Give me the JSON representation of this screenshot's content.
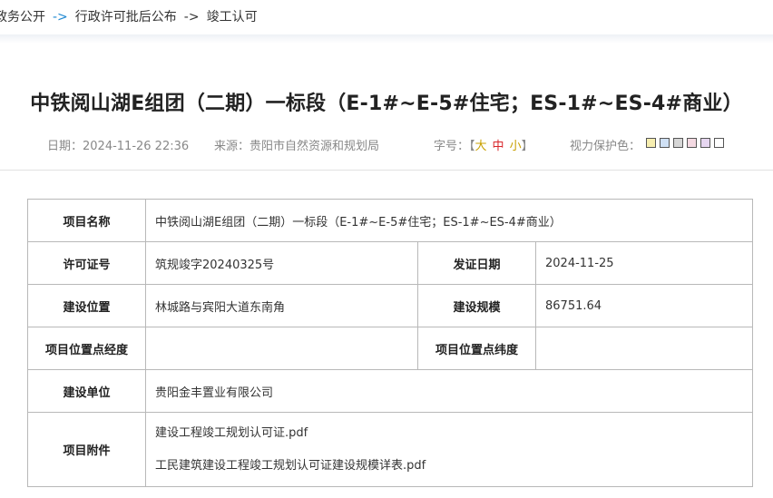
{
  "breadcrumb": {
    "items": [
      "政务公开",
      "行政许可批后公布",
      "竣工认可"
    ],
    "separator": "->"
  },
  "article": {
    "title": "中铁阅山湖E组团（二期）一标段（E-1#~E-5#住宅；ES-1#~ES-4#商业）",
    "date": "日期：2024-11-26 22:36",
    "source": "来源：贵阳市自然资源和规划局",
    "font_size": {
      "label": "字号：",
      "open": "【",
      "large": "大",
      "medium": "中",
      "small": "小",
      "close": "】"
    },
    "eye_protection_label": "视力保护色：",
    "eye_colors": [
      "#f7eeb0",
      "#cfe0f4",
      "#d6d6d6",
      "#f4d9e2",
      "#e6d6f0",
      "#ffffff"
    ]
  },
  "table": {
    "project_name_label": "项目名称",
    "project_name": "中铁阅山湖E组团（二期）一标段（E-1#~E-5#住宅；ES-1#~ES-4#商业）",
    "permit_no_label": "许可证号",
    "permit_no": "筑规竣字20240325号",
    "issue_date_label": "发证日期",
    "issue_date": "2024-11-25",
    "location_label": "建设位置",
    "location": "林城路与宾阳大道东南角",
    "scale_label": "建设规模",
    "scale": "86751.64",
    "longitude_label": "项目位置点经度",
    "longitude": "",
    "latitude_label": "项目位置点纬度",
    "latitude": "",
    "builder_label": "建设单位",
    "builder": "贵阳金丰置业有限公司",
    "attachments_label": "项目附件",
    "attachments": [
      "建设工程竣工规划认可证.pdf",
      "工民建筑建设工程竣工规划认可证建设规模详表.pdf"
    ]
  }
}
